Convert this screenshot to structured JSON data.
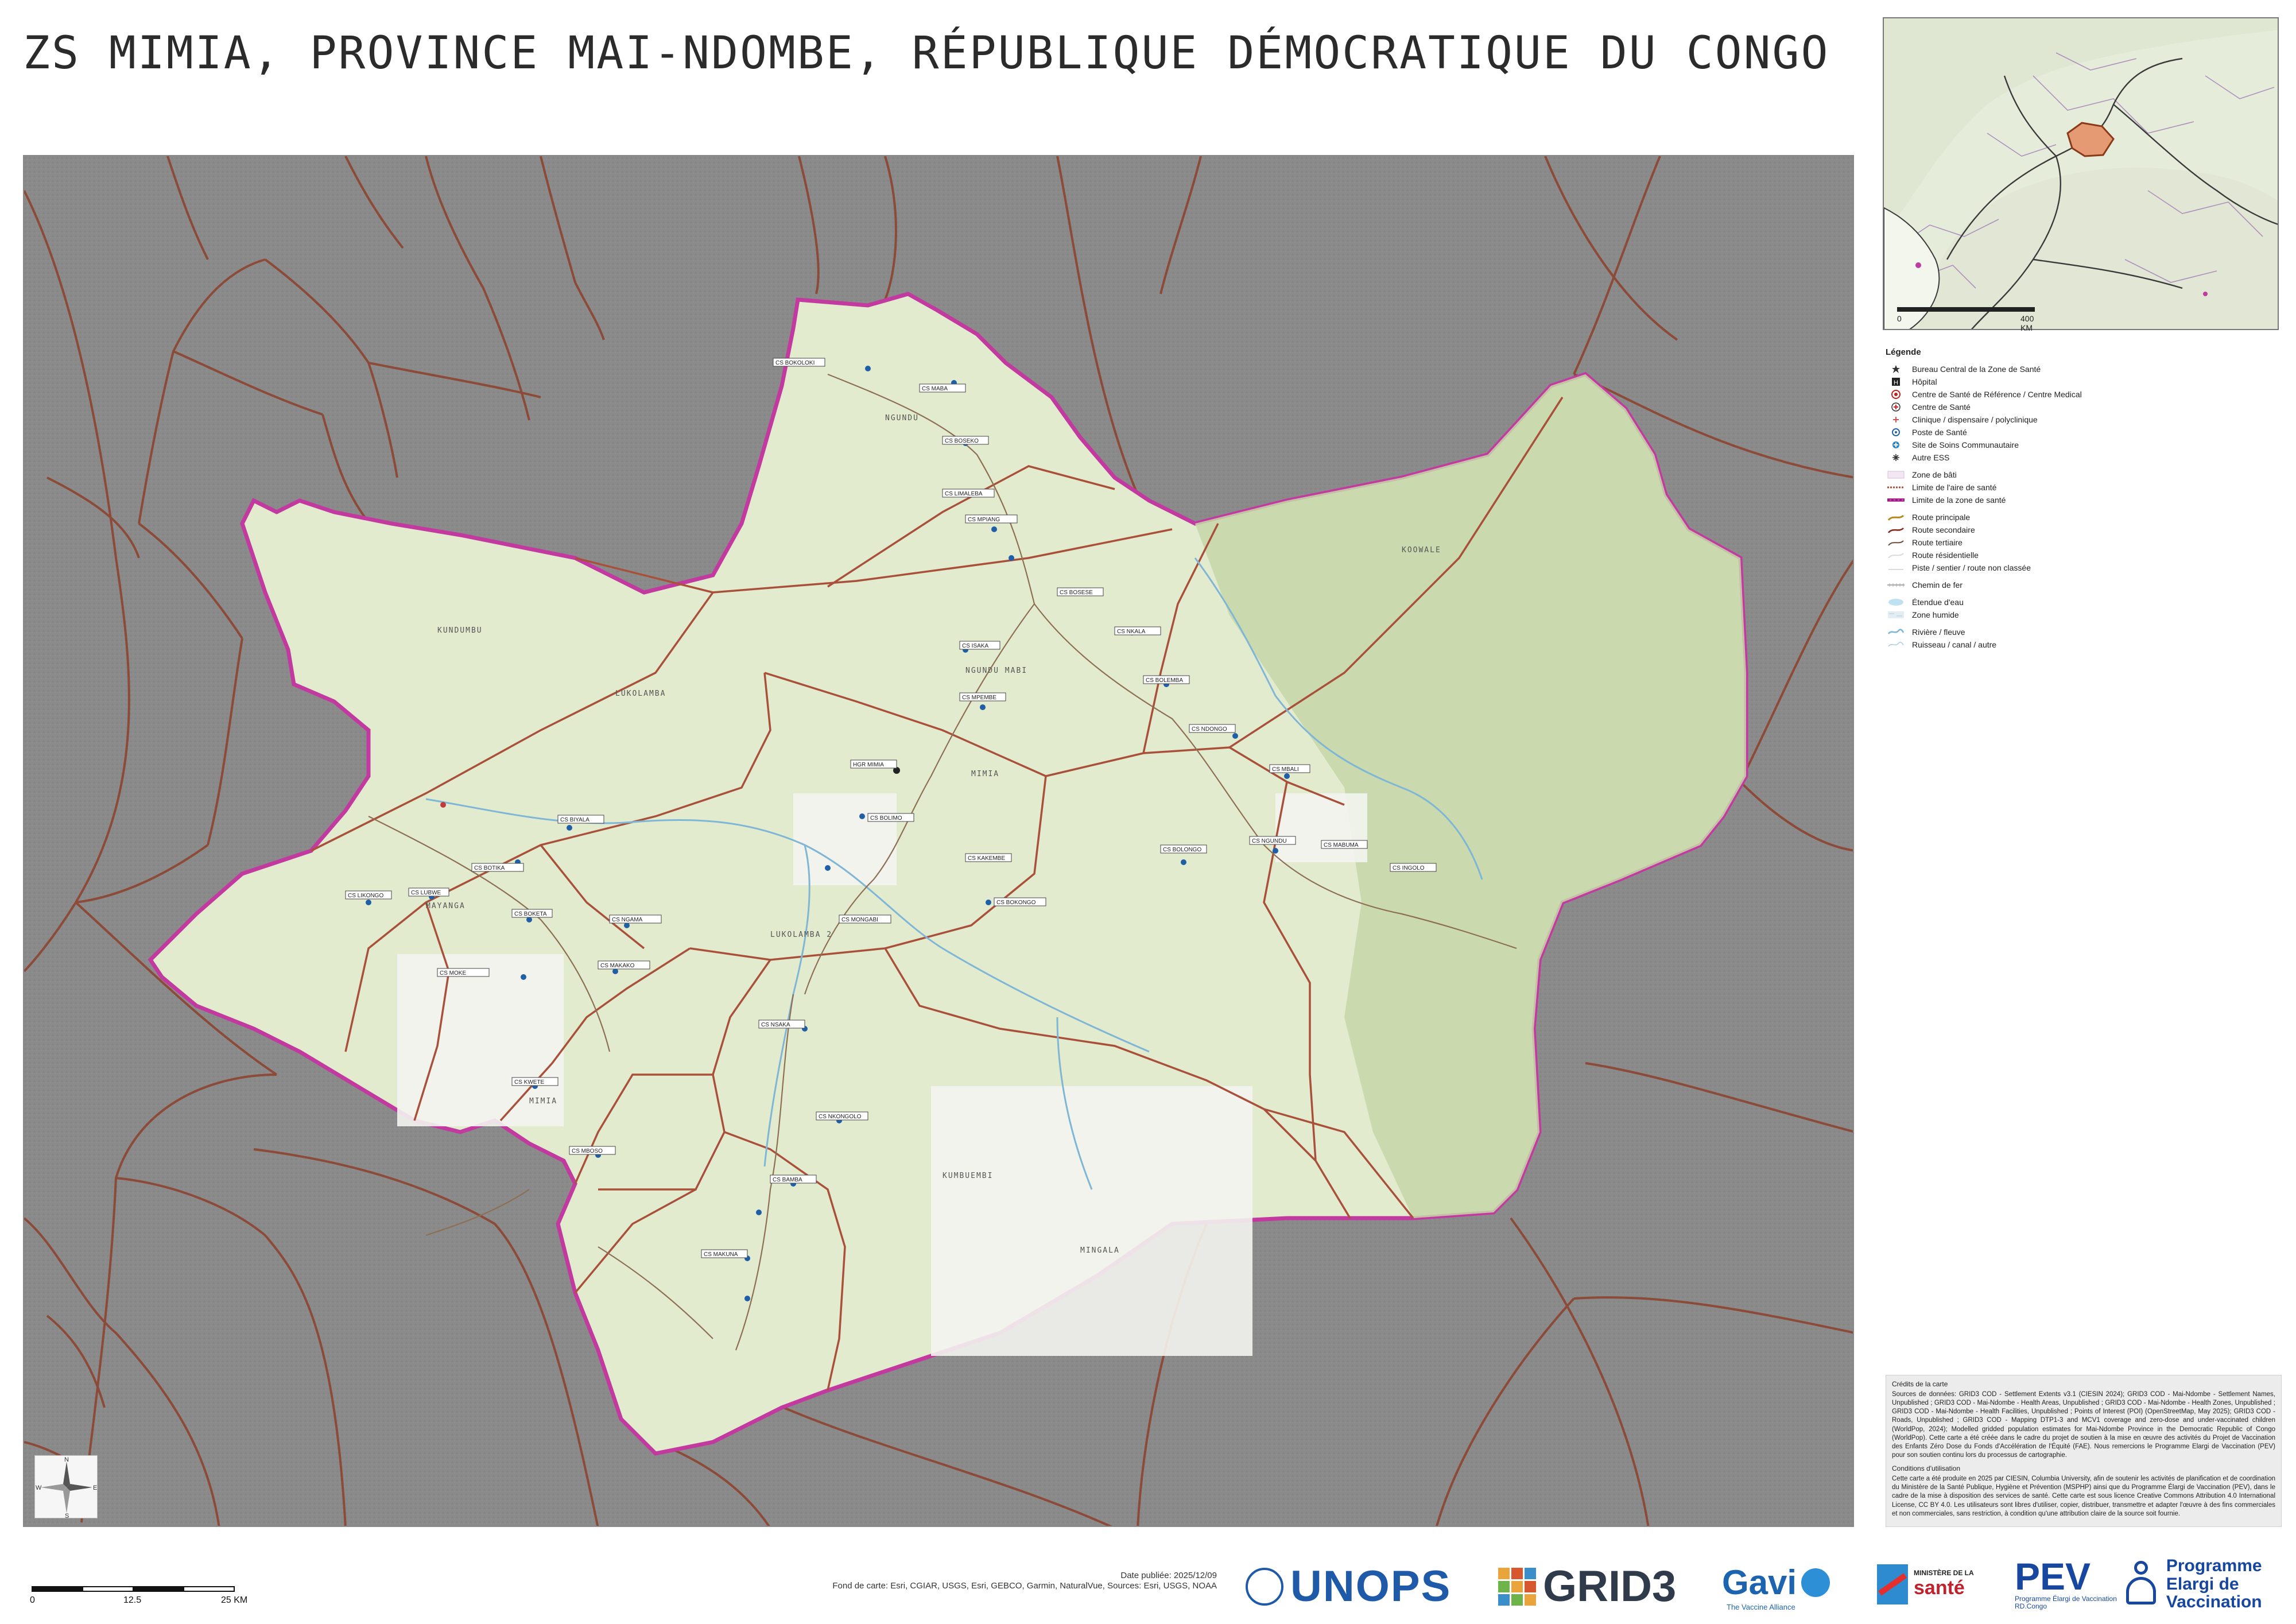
{
  "title": "ZS MIMIA, PROVINCE MAI-NDOMBE, RÉPUBLIQUE DÉMOCRATIQUE DU CONGO",
  "colors": {
    "outside_area": "#8a8a8a",
    "zone_fill": "#e3ebcf",
    "forest_fill": "#c6d7a8",
    "zone_boundary": "#c23aa0",
    "area_boundary": "#a9503a",
    "river": "#7fb6d6",
    "road": "#8c6f54"
  },
  "map_labels": {
    "places": [
      "KUNDUMBU",
      "LUKOLAMBA",
      "MIMIA",
      "LUKOLAMBA 2",
      "KOOWALE",
      "NGUNDU",
      "NGUNDU MABI",
      "MAYANGA",
      "KUMBUEMBI",
      "MIMIA",
      "MINGALA"
    ],
    "facilities": [
      "CS BOKOLOKI",
      "CS MABA",
      "CS BOSEKO",
      "CS LIMALEBA",
      "CS MPIANG",
      "CS BOSESE",
      "CS NKALA",
      "CS BOLEMBA",
      "CS NDONGO",
      "HGR MIMIA",
      "CS MPEMBE",
      "CS ISAKA",
      "CS BOLIMO",
      "CS KAKEMBE",
      "CS MONGABI",
      "CS BOKONGO",
      "CS BOLONGO",
      "CS NGUNDU",
      "CS MABUMA",
      "CS INGOLO",
      "CS MBALI",
      "CS BIYALA",
      "CS BOTIKA",
      "CS LIKONGO",
      "CS LUBWE",
      "CS BOKETA",
      "CS NGAMA",
      "CS MAKAKO",
      "CS MOKE",
      "CS NSAKA",
      "CS KWETE",
      "CS MBOSO",
      "CS NKONGOLO",
      "CS BAMBA",
      "CS MAKUNA"
    ]
  },
  "inset": {
    "scale_start": "0",
    "scale_end": "400 KM"
  },
  "legend": {
    "title": "Légende",
    "items": [
      {
        "label": "Bureau Central de la Zone de Santé",
        "icon": "bureau-icon"
      },
      {
        "label": "Hôpital",
        "icon": "hospital-icon"
      },
      {
        "label": "Centre de Santé de Référence / Centre Medical",
        "icon": "csr-icon"
      },
      {
        "label": "Centre de Santé",
        "icon": "cs-icon"
      },
      {
        "label": "Clinique / dispensaire / polyclinique",
        "icon": "clinic-icon"
      },
      {
        "label": "Poste de Santé",
        "icon": "poste-icon"
      },
      {
        "label": "Site de Soins Communautaire",
        "icon": "site-icon"
      },
      {
        "label": "Autre ESS",
        "icon": "other-icon"
      },
      {
        "label": "Zone de bâti",
        "icon": "builtup-swatch"
      },
      {
        "label": "Limite de l'aire de santé",
        "icon": "area-limit-line"
      },
      {
        "label": "Limite de la zone de santé",
        "icon": "zone-limit-line"
      },
      {
        "label": "Route principale",
        "icon": "main-road-line"
      },
      {
        "label": "Route secondaire",
        "icon": "secondary-road-line"
      },
      {
        "label": "Route tertiaire",
        "icon": "tertiary-road-line"
      },
      {
        "label": "Route résidentielle",
        "icon": "residential-road-line"
      },
      {
        "label": "Piste / sentier / route non classée",
        "icon": "track-line"
      },
      {
        "label": "Chemin de fer",
        "icon": "railway-line"
      },
      {
        "label": "Étendue d'eau",
        "icon": "water-swatch"
      },
      {
        "label": "Zone humide",
        "icon": "wetland-swatch"
      },
      {
        "label": "Rivière / fleuve",
        "icon": "river-line"
      },
      {
        "label": "Ruisseau / canal / autre",
        "icon": "stream-line"
      }
    ]
  },
  "credits": {
    "heading": "Crédits de la carte",
    "sources": "Sources de données: GRID3 COD - Settlement Extents v3.1 (CIESIN 2024); GRID3 COD - Mai-Ndombe - Settlement Names, Unpublished ; GRID3 COD - Mai-Ndombe - Health Areas, Unpublished ; GRID3 COD - Mai-Ndombe - Health Zones, Unpublished ; GRID3 COD - Mai-Ndombe - Health Facilities, Unpublished ; Points of Interest (POI) (OpenStreetMap, May 2025); GRID3 COD - Roads, Unpublished ; GRID3 COD - Mapping DTP1-3 and MCV1 coverage and zero-dose and under-vaccinated children (WorldPop, 2024); Modelled gridded population estimates for Mai-Ndombe Province in the Democratic Republic of Congo (WorldPop). Cette carte a été créée dans le cadre du projet de soutien à la mise en œuvre des activités du Projet de Vaccination des Enfants Zéro Dose du Fonds d'Accélération de l'Équité (FAE). Nous remercions le Programme Elargi de Vaccination (PEV) pour son soutien continu lors du processus de cartographie.",
    "conditions_heading": "Conditions d'utilisation",
    "conditions": "Cette carte a été produite en 2025 par CIESIN, Columbia University, afin de soutenir les activités de planification et de coordination du Ministère de la Santé Publique, Hygiène et Prévention (MSPHP) ainsi que du Programme Élargi de Vaccination (PEV), dans le cadre de la mise à disposition des services de santé. Cette carte est sous licence Creative Commons Attribution 4.0 International License, CC BY 4.0. Les utilisateurs sont libres d'utiliser, copier, distribuer, transmettre et adapter l'œuvre à des fins commerciales et non commerciales, sans restriction, à condition qu'une attribution claire de la source soit fournie."
  },
  "compass": {
    "n": "N",
    "s": "S",
    "e": "E",
    "w": "W"
  },
  "scalebar": {
    "start": "0",
    "mid": "12.5",
    "end": "25 KM"
  },
  "date_published": "Date publiée: 2025/12/09",
  "basemap_credit": "Fond de carte: Esri, CGIAR, USGS, Esri, GEBCO, Garmin, NaturalVue, Sources: Esri, USGS, NOAA",
  "logos": {
    "unops": "UNOPS",
    "grid3": "GRID3",
    "gavi": "Gavi",
    "gavi_sub": "The Vaccine Alliance",
    "ministry": "MINISTÈRE DE LA",
    "sante": "santé",
    "pev": "PEV",
    "pev_sub1": "Programme Élargi de Vaccination",
    "pev_sub2": "RD.Congo",
    "program_line1": "Programme",
    "program_line2": "Elargi de",
    "program_line3": "Vaccination"
  }
}
